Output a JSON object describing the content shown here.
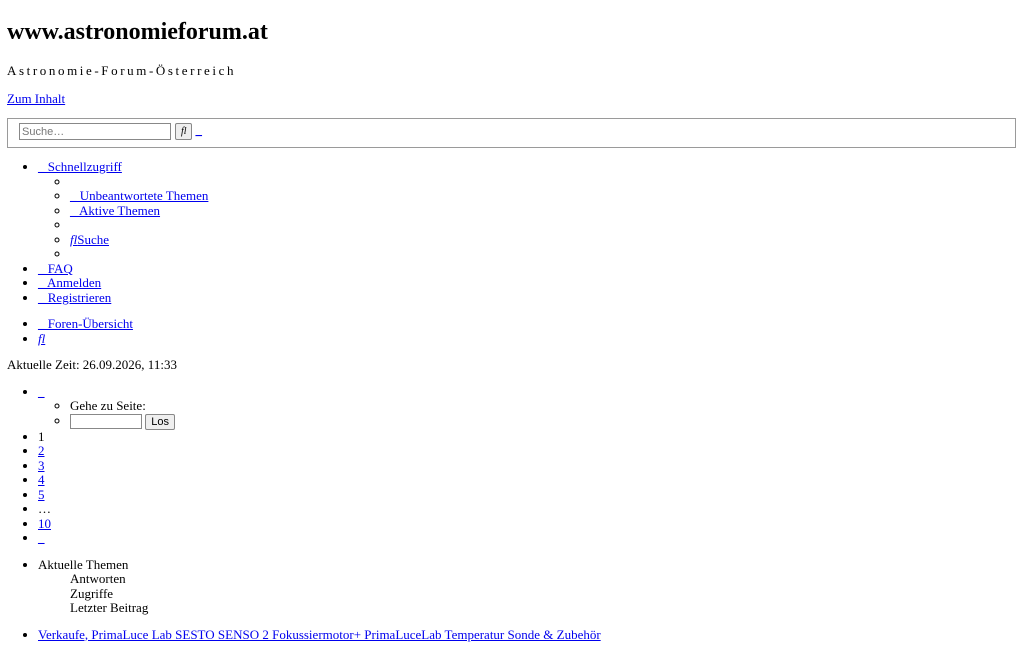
{
  "site": {
    "title": "www.astronomieforum.at",
    "tagline": "Astronomie-Forum-Österreich",
    "skip_link": "Zum Inhalt"
  },
  "search": {
    "placeholder": "Suche…",
    "submit_glyph": "fl",
    "advanced_label": "_"
  },
  "nav": {
    "quicklinks_label": "_ Schnellzugriff",
    "quicklinks_items": [
      "",
      "_ Unbeantwortete Themen",
      "_ Aktive Themen",
      "",
      "Suche",
      ""
    ],
    "search_glyph": "fl",
    "faq": "_ FAQ",
    "login": "_ Anmelden",
    "register": "_ Registrieren"
  },
  "breadcrumb": {
    "index": "_ Foren-Übersicht",
    "extra": "fl"
  },
  "current_time": "Aktuelle Zeit: 26.09.2026, 11:33",
  "pagination": {
    "toggle": "_",
    "goto_label": "Gehe zu Seite:",
    "goto_button": "Los",
    "current": "1",
    "pages": [
      "2",
      "3",
      "4",
      "5"
    ],
    "ellipsis": "…",
    "last": "10",
    "next": "_"
  },
  "topics": {
    "header": "Aktuelle Themen",
    "columns": [
      "Antworten",
      "Zugriffe",
      "Letzter Beitrag"
    ],
    "first_topic": "Verkaufe, PrimaLuce Lab SESTO SENSO 2 Fokussiermotor+ PrimaLuceLab Temperatur Sonde & Zubehör"
  }
}
